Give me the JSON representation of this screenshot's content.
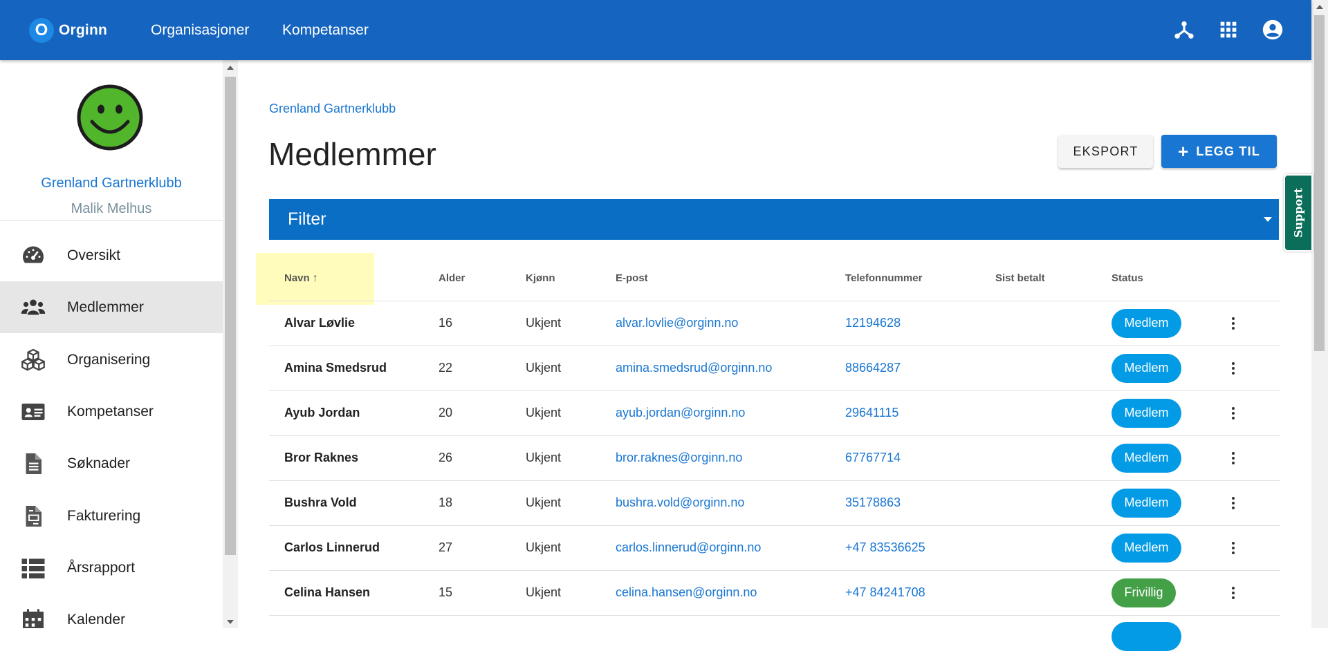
{
  "appbar": {
    "logo_letter": "O",
    "brand": "Orginn",
    "nav": [
      "Organisasjoner",
      "Kompetanser"
    ],
    "icons": [
      "hub-icon",
      "apps-grid-icon",
      "account-circle-icon"
    ],
    "color": "#1565c0"
  },
  "sidebar": {
    "org_name": "Grenland Gartnerklubb",
    "user_name": "Malik Melhus",
    "items": [
      {
        "label": "Oversikt",
        "icon": "speedometer-icon"
      },
      {
        "label": "Medlemmer",
        "icon": "people-icon",
        "active": true
      },
      {
        "label": "Organisering",
        "icon": "cubes-icon"
      },
      {
        "label": "Kompetanser",
        "icon": "id-card-icon"
      },
      {
        "label": "Søknader",
        "icon": "document-icon"
      },
      {
        "label": "Fakturering",
        "icon": "invoice-icon"
      },
      {
        "label": "Årsrapport",
        "icon": "list-icon"
      },
      {
        "label": "Kalender",
        "icon": "calendar-icon"
      }
    ]
  },
  "main": {
    "breadcrumb": "Grenland Gartnerklubb",
    "title": "Medlemmer",
    "export_label": "EKSPORT",
    "add_label": "LEGG TIL",
    "filter_label": "Filter",
    "support_label": "Support"
  },
  "table": {
    "headers": [
      "Navn",
      "Alder",
      "Kjønn",
      "E-post",
      "Telefonnummer",
      "Sist betalt",
      "Status"
    ],
    "sort": {
      "column": "Navn",
      "direction": "ascending"
    },
    "rows": [
      {
        "name": "Alvar Løvlie",
        "age": "16",
        "gender": "Ukjent",
        "email": "alvar.lovlie@orginn.no",
        "phone": "12194628",
        "last_paid": "",
        "status": "Medlem"
      },
      {
        "name": "Amina Smedsrud",
        "age": "22",
        "gender": "Ukjent",
        "email": "amina.smedsrud@orginn.no",
        "phone": "88664287",
        "last_paid": "",
        "status": "Medlem"
      },
      {
        "name": "Ayub Jordan",
        "age": "20",
        "gender": "Ukjent",
        "email": "ayub.jordan@orginn.no",
        "phone": "29641115",
        "last_paid": "",
        "status": "Medlem"
      },
      {
        "name": "Bror Raknes",
        "age": "26",
        "gender": "Ukjent",
        "email": "bror.raknes@orginn.no",
        "phone": "67767714",
        "last_paid": "",
        "status": "Medlem"
      },
      {
        "name": "Bushra Vold",
        "age": "18",
        "gender": "Ukjent",
        "email": "bushra.vold@orginn.no",
        "phone": "35178863",
        "last_paid": "",
        "status": "Medlem"
      },
      {
        "name": "Carlos Linnerud",
        "age": "27",
        "gender": "Ukjent",
        "email": "carlos.linnerud@orginn.no",
        "phone": "+47 83536625",
        "last_paid": "",
        "status": "Medlem"
      },
      {
        "name": "Celina Hansen",
        "age": "15",
        "gender": "Ukjent",
        "email": "celina.hansen@orginn.no",
        "phone": "+47 84241708",
        "last_paid": "",
        "status": "Frivillig"
      }
    ],
    "status_colors": {
      "Medlem": "#039be5",
      "Frivillig": "#43a047"
    }
  }
}
